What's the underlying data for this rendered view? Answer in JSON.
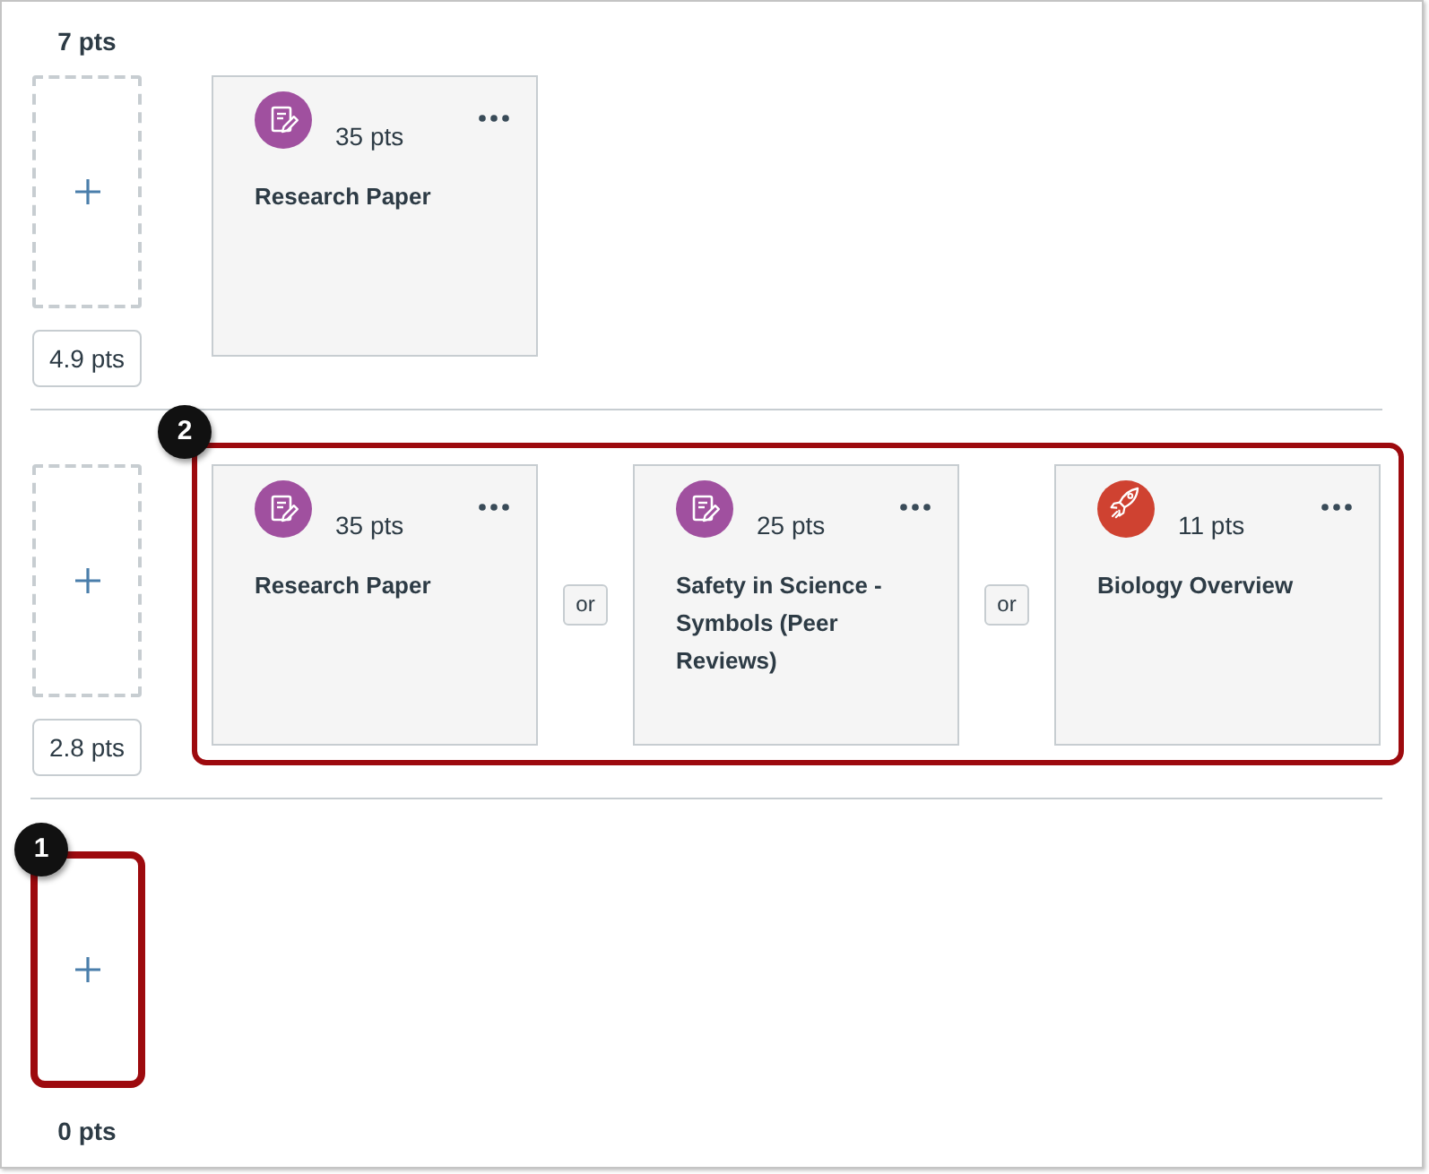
{
  "top_score": "7 pts",
  "ranges": [
    {
      "cards": [
        {
          "kind": "assignment",
          "points": "35 pts",
          "title": "Research Paper"
        }
      ],
      "lower_score": "4.9 pts"
    },
    {
      "cards_callout": "2",
      "cards": [
        {
          "kind": "assignment",
          "points": "35 pts",
          "title": "Research Paper"
        },
        {
          "connector": "or",
          "kind": "assignment",
          "points": "25 pts",
          "title": "Safety in Science - Symbols (Peer Reviews)"
        },
        {
          "connector": "or",
          "kind": "quiz",
          "points": "11 pts",
          "title": "Biology Overview"
        }
      ],
      "lower_score": "2.8 pts"
    },
    {
      "slot_callout": "1"
    }
  ],
  "bottom_score": "0 pts"
}
